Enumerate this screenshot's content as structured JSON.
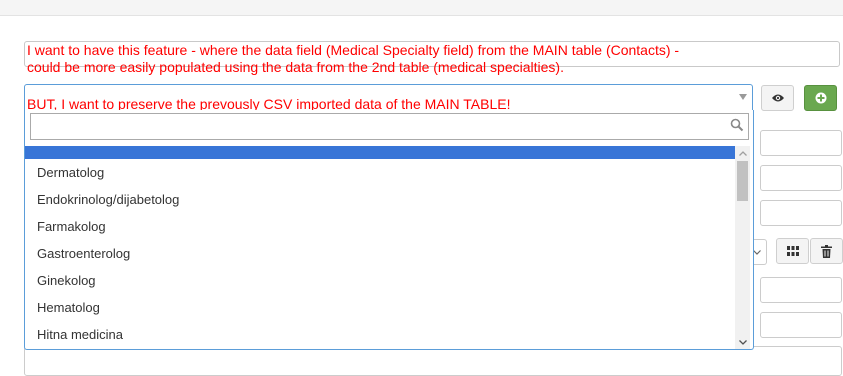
{
  "notes": {
    "line1": "I want to have this feature - where the data field (Medical Specialty field) from the MAIN table (Contacts) -",
    "line2": "could be more easily populated using the data from the 2nd table (medical specialties).",
    "line3": "BUT, I want to preserve the prevously CSV imported data of the MAIN TABLE!"
  },
  "colors": {
    "note_text": "#ff0000",
    "highlight": "#3875d7",
    "add_button": "#6aa84f"
  },
  "select": {
    "selected_value": "",
    "search_value": "",
    "search_placeholder": ""
  },
  "options": [
    "",
    "Dermatolog",
    "Endokrinolog/dijabetolog",
    "Farmakolog",
    "Gastroenterolog",
    "Ginekolog",
    "Hematolog",
    "Hitna medicina"
  ],
  "icons": {
    "view": "eye-icon",
    "add": "plus-circle-icon",
    "search": "search-icon",
    "grid": "grid-icon",
    "delete": "trash-icon"
  }
}
